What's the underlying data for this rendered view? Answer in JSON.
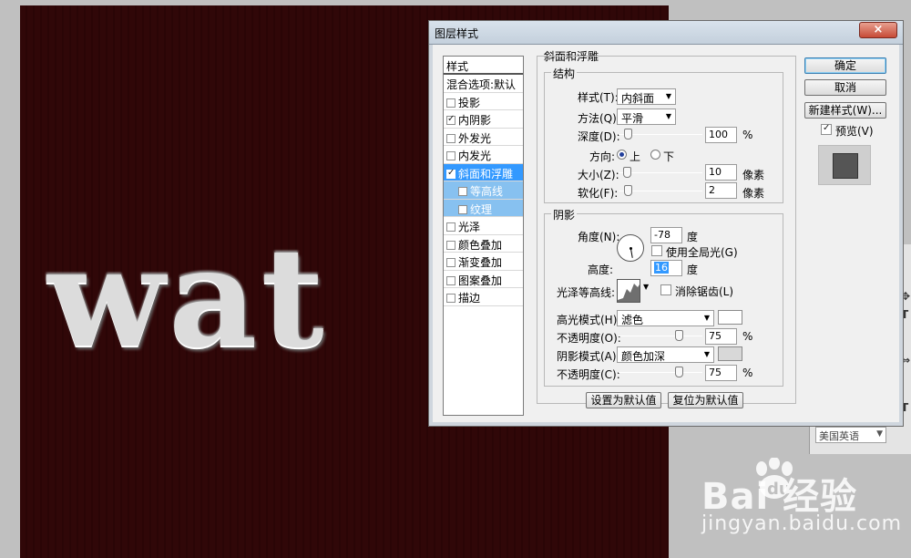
{
  "canvas": {
    "text": "wat"
  },
  "dialog": {
    "title": "图层样式",
    "close_label": "×",
    "styles_header": "样式",
    "blend_options": "混合选项:默认",
    "effects": [
      {
        "label": "投影",
        "checked": false
      },
      {
        "label": "内阴影",
        "checked": true
      },
      {
        "label": "外发光",
        "checked": false
      },
      {
        "label": "内发光",
        "checked": false
      },
      {
        "label": "斜面和浮雕",
        "checked": true,
        "selected": true
      },
      {
        "label": "等高线",
        "checked": false,
        "sub": true
      },
      {
        "label": "纹理",
        "checked": false,
        "sub": true
      },
      {
        "label": "光泽",
        "checked": false
      },
      {
        "label": "颜色叠加",
        "checked": false
      },
      {
        "label": "渐变叠加",
        "checked": false
      },
      {
        "label": "图案叠加",
        "checked": false
      },
      {
        "label": "描边",
        "checked": false
      }
    ],
    "bevel": {
      "group_title": "斜面和浮雕",
      "structure_title": "结构",
      "style_label": "样式(T):",
      "style_value": "内斜面",
      "technique_label": "方法(Q):",
      "technique_value": "平滑",
      "depth_label": "深度(D):",
      "depth_value": "100",
      "depth_unit": "%",
      "direction_label": "方向:",
      "direction_up": "上",
      "direction_down": "下",
      "size_label": "大小(Z):",
      "size_value": "10",
      "size_unit": "像素",
      "soften_label": "软化(F):",
      "soften_value": "2",
      "soften_unit": "像素"
    },
    "shading": {
      "title": "阴影",
      "angle_label": "角度(N):",
      "angle_value": "-78",
      "angle_unit": "度",
      "global_light_label": "使用全局光(G)",
      "global_light_checked": false,
      "altitude_label": "高度:",
      "altitude_value": "16",
      "altitude_unit": "度",
      "gloss_contour_label": "光泽等高线:",
      "anti_alias_label": "消除锯齿(L)",
      "anti_alias_checked": false,
      "highlight_mode_label": "高光模式(H):",
      "highlight_mode_value": "滤色",
      "highlight_color": "#ffffff",
      "highlight_opacity_label": "不透明度(O):",
      "highlight_opacity_value": "75",
      "shadow_mode_label": "阴影模式(A):",
      "shadow_mode_value": "颜色加深",
      "shadow_color": "#d8d8d8",
      "shadow_opacity_label": "不透明度(C):",
      "shadow_opacity_value": "75",
      "percent": "%"
    },
    "buttons": {
      "set_default": "设置为默认值",
      "reset_default": "复位为默认值",
      "ok": "确定",
      "cancel": "取消",
      "new_style": "新建样式(W)...",
      "preview_label": "预览(V)"
    }
  },
  "right_panel": {
    "language": "美国英语"
  },
  "watermark": {
    "logo": "Bai  经验",
    "url": "jingyan.baidu.com"
  }
}
